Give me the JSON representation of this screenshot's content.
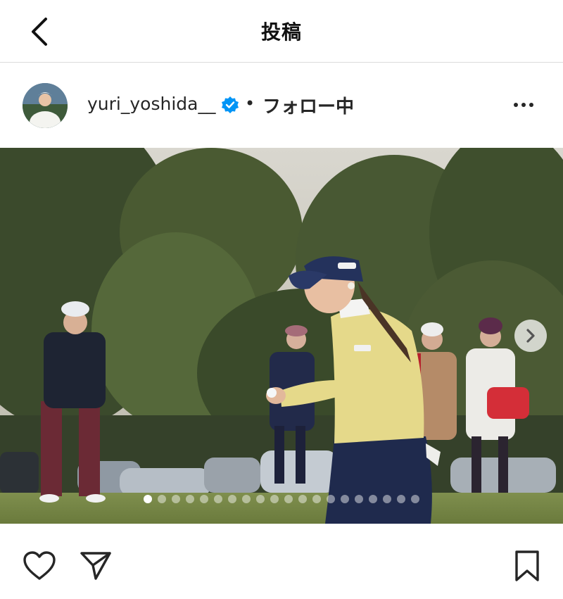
{
  "header": {
    "title": "投稿",
    "back_icon": "chevron-left-icon"
  },
  "post": {
    "username": "yuri_yoshida__",
    "verified": true,
    "separator": "•",
    "follow_status": "フォロー中",
    "more_icon": "more-horizontal-icon"
  },
  "media": {
    "description_icon": "golf-photo",
    "slide_count": 20,
    "current_slide": 1,
    "next_icon": "chevron-right-icon"
  },
  "actions": {
    "like_icon": "heart-icon",
    "share_icon": "send-icon",
    "save_icon": "bookmark-icon"
  },
  "colors": {
    "verified_blue": "#0095f6",
    "text": "#262626",
    "divider": "#dbdbdb"
  }
}
